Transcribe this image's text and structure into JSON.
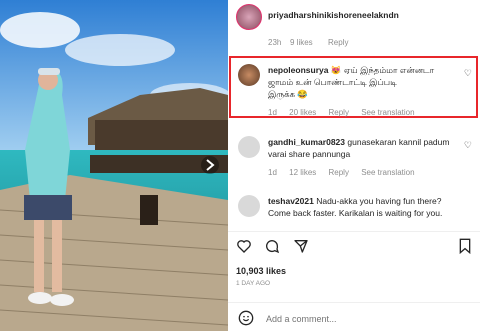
{
  "post": {
    "author": "priyadharshinikishoreneelakndn",
    "comment_time": "23h",
    "comment_likes": "9 likes",
    "reply_label": "Reply"
  },
  "comments": [
    {
      "username": "nepoleonsurya",
      "text_line1": "ஏய் இந்தம்மா என்னடா",
      "text_line2": "ஜாமம் உன் பொண்டாட்டி இப்படி",
      "text_line3": "இருக்க 😂",
      "emoji": "😻",
      "meta_time": "1d",
      "meta_likes": "20 likes",
      "meta_reply": "Reply",
      "meta_translation": "See translation"
    },
    {
      "username": "gandhi_kumar0823",
      "text": "gunasekaran kannil padum varai share pannunga",
      "meta_time": "1d",
      "meta_likes": "12 likes",
      "meta_reply": "Reply",
      "meta_translation": "See translation"
    },
    {
      "username": "teshav2021",
      "text": "Nadu-akka you having fun there? Come back faster. Karikalan is waiting for you."
    }
  ],
  "likes_count": "10,903 likes",
  "post_age": "1 DAY AGO",
  "add_comment_placeholder": "Add a comment...",
  "colors": {
    "highlight": "#e8262b",
    "text": "#262626",
    "muted": "#8e8e8e"
  }
}
